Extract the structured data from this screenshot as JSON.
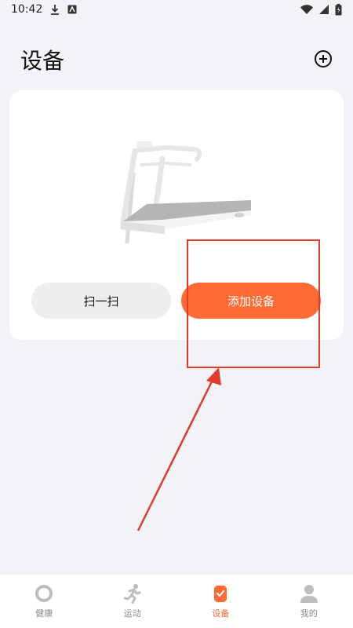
{
  "status_bar": {
    "time": "10:42"
  },
  "header": {
    "title": "设备"
  },
  "card": {
    "scan_label": "扫一扫",
    "add_device_label": "添加设备"
  },
  "tabs": [
    {
      "label": "健康",
      "icon": "ring-icon",
      "active": false
    },
    {
      "label": "运动",
      "icon": "running-icon",
      "active": false
    },
    {
      "label": "设备",
      "icon": "device-badge-icon",
      "active": true
    },
    {
      "label": "我的",
      "icon": "person-icon",
      "active": false
    }
  ],
  "colors": {
    "accent": "#ff6a35",
    "annotation": "#e23b2e",
    "background": "#f2f3f7"
  }
}
